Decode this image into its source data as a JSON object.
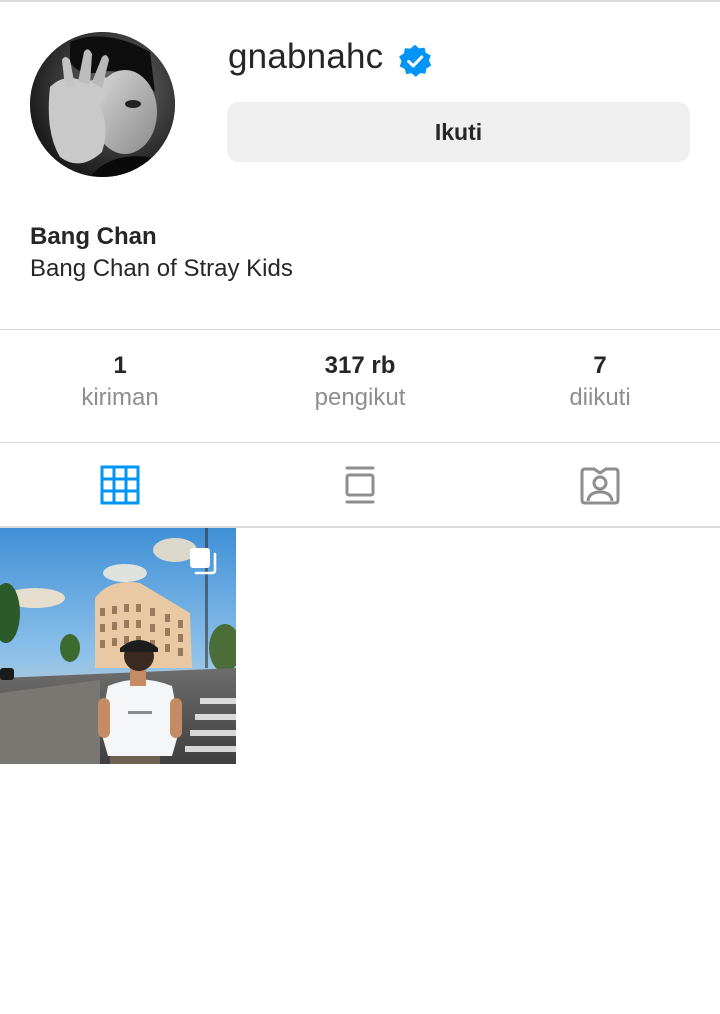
{
  "profile": {
    "username": "gnabnahc",
    "verified_icon": "verified-badge-icon",
    "follow_label": "Ikuti",
    "full_name": "Bang Chan",
    "bio": "Bang Chan of Stray Kids"
  },
  "stats": [
    {
      "value": "1",
      "label": "kiriman"
    },
    {
      "value": "317 rb",
      "label": "pengikut"
    },
    {
      "value": "7",
      "label": "diikuti"
    }
  ],
  "tabs": [
    {
      "icon": "grid-icon",
      "active": true
    },
    {
      "icon": "feed-icon",
      "active": false
    },
    {
      "icon": "tagged-icon",
      "active": false
    }
  ],
  "posts": [
    {
      "icon": "multiple-posts-icon"
    }
  ],
  "colors": {
    "accent": "#0095f6",
    "verified": "#0095f6",
    "muted_text": "#8e8e8e",
    "button_bg": "#efefef",
    "divider": "#dbdbdb"
  }
}
